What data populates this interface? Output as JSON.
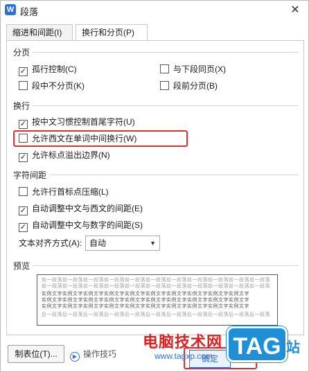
{
  "window": {
    "title": "段落",
    "app_icon_letter": "W"
  },
  "tabs": [
    {
      "label": "缩进和间距(I)",
      "active": false
    },
    {
      "label": "换行和分页(P)",
      "active": true
    }
  ],
  "sections": {
    "pagination": {
      "label": "分页",
      "options": [
        {
          "label": "孤行控制(C)",
          "checked": true
        },
        {
          "label": "与下段同页(X)",
          "checked": false
        },
        {
          "label": "段中不分页(K)",
          "checked": false
        },
        {
          "label": "段前分页(B)",
          "checked": false
        }
      ]
    },
    "line_break": {
      "label": "换行",
      "options": [
        {
          "label": "按中文习惯控制首尾字符(U)",
          "checked": true
        },
        {
          "label": "允许西文在单词中间换行(W)",
          "checked": false
        },
        {
          "label": "允许标点溢出边界(N)",
          "checked": true
        }
      ]
    },
    "char_spacing": {
      "label": "字符间距",
      "options": [
        {
          "label": "允许行首标点压缩(L)",
          "checked": false
        },
        {
          "label": "自动调整中文与西文的间距(E)",
          "checked": true
        },
        {
          "label": "自动调整中文与数字的间距(S)",
          "checked": true
        }
      ],
      "text_align_label": "文本对齐方式(A):",
      "text_align_value": "自动"
    },
    "preview": {
      "label": "预览",
      "lines": [
        "前一段落前一段落前一段落前一段落前一段落前一段落前一段落前一段落前一段落前一段落前一段落",
        "前一段落前一段落前一段落前一段落前一段落前一段落前一段落前一段落前一段落前一段落前一段落",
        "实例文字实例文字实例文字实例文字实例文字实例文字实例文字实例文字实例文字实例文字",
        "实例文字实例文字实例文字实例文字实例文字实例文字实例文字实例文字实例文字实例文字",
        "实例文字实例文字实例文字实例文字实例文字实例文字实例文字实例文字实例文字实例文字",
        "后一段落后一段落后一段落后一段落后一段落后一段落后一段落后一段落后一段落后一段落后一段落"
      ]
    }
  },
  "footer": {
    "tab_stops_button": "制表位(T)...",
    "tips_label": "操作技巧",
    "ok_button": "确定"
  },
  "watermark": {
    "text": "电脑技术网",
    "url": "www.tagxp.com",
    "logo": "TAG",
    "logo_suffix": "站"
  },
  "colors": {
    "highlight": "#e03030",
    "accent": "#2f6fd6",
    "watermark_red": "#e02020",
    "tag_blue": "#1f8fd8"
  }
}
